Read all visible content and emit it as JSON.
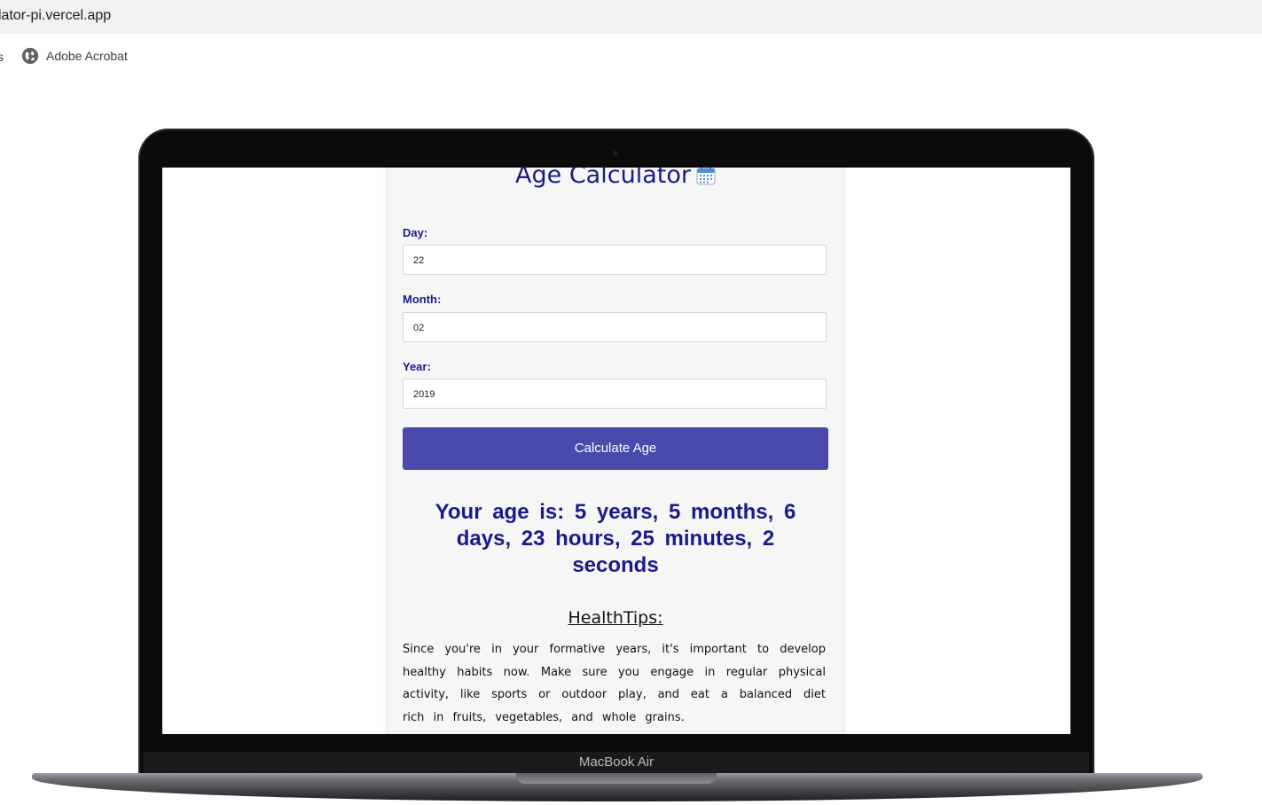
{
  "browser": {
    "url": "lator-pi.vercel.app",
    "bookmarks": {
      "partial_label": "s",
      "items": [
        {
          "label": "Adobe Acrobat",
          "icon": "globe-icon"
        }
      ]
    }
  },
  "device": {
    "label": "MacBook Air"
  },
  "app": {
    "title": "Age Calculator",
    "title_icon": "calendar-icon",
    "accent_color": "#1a1a8c",
    "button_color": "#4a4aac",
    "fields": [
      {
        "label": "Day:",
        "value": "22"
      },
      {
        "label": "Month:",
        "value": "02"
      },
      {
        "label": "Year:",
        "value": "2019"
      }
    ],
    "calculate_label": "Calculate Age",
    "result": "Your age is: 5 years, 5 months, 6 days, 23 hours, 25 minutes, 2 seconds",
    "tips_title": "HealthTips:",
    "tips_body": "Since you're in your formative years, it's important to develop healthy habits now. Make sure you engage in regular physical activity, like sports or outdoor play, and eat a balanced diet rich in fruits, vegetables, and whole grains."
  }
}
